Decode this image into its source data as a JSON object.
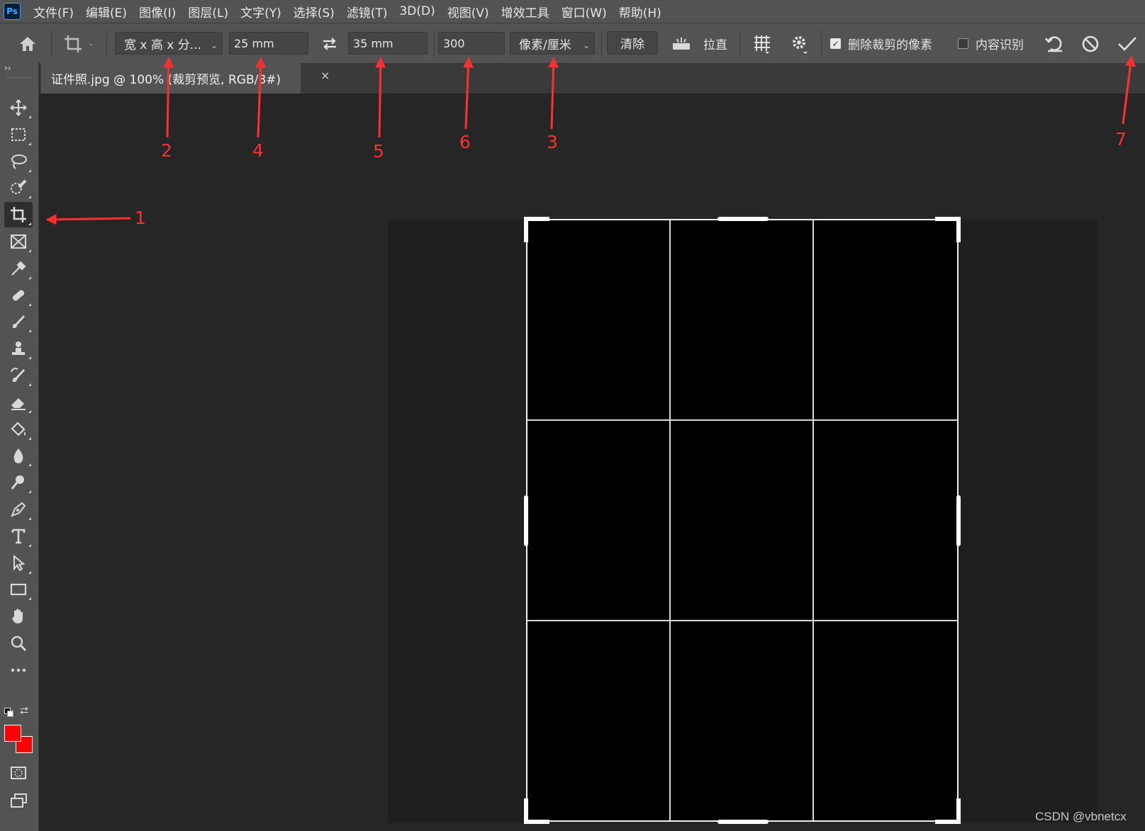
{
  "app": {
    "logo": "Ps"
  },
  "menu": [
    "文件(F)",
    "编辑(E)",
    "图像(I)",
    "图层(L)",
    "文字(Y)",
    "选择(S)",
    "滤镜(T)",
    "3D(D)",
    "视图(V)",
    "增效工具",
    "窗口(W)",
    "帮助(H)"
  ],
  "options": {
    "ratio_preset": "宽 x 高 x 分...",
    "width": "25 mm",
    "height": "35 mm",
    "resolution": "300",
    "resolution_unit": "像素/厘米",
    "clear_label": "清除",
    "straighten_label": "拉直",
    "delete_cropped_label": "删除裁剪的像素",
    "delete_cropped_checked": true,
    "content_aware_label": "内容识别",
    "content_aware_checked": false
  },
  "document": {
    "tab_title": "证件照.jpg @ 100% (裁剪预览, RGB/8#)",
    "close_glyph": "×"
  },
  "toolbar": {
    "expand_glyph": "››",
    "tools": [
      "move",
      "marquee",
      "lasso",
      "quick-select",
      "crop",
      "frame",
      "eyedropper",
      "healing",
      "brush",
      "stamp",
      "history-brush",
      "eraser",
      "paint-bucket",
      "blur",
      "dodge",
      "pen",
      "type",
      "path-select",
      "rectangle",
      "hand",
      "zoom",
      "more"
    ],
    "active_tool": "crop",
    "foreground_color": "#ff0000",
    "background_color": "#ff0000"
  },
  "annotations": [
    "1",
    "2",
    "3",
    "4",
    "5",
    "6",
    "7"
  ],
  "annotation_color": "#ff2f2f",
  "watermark": "CSDN @vbnetcx"
}
